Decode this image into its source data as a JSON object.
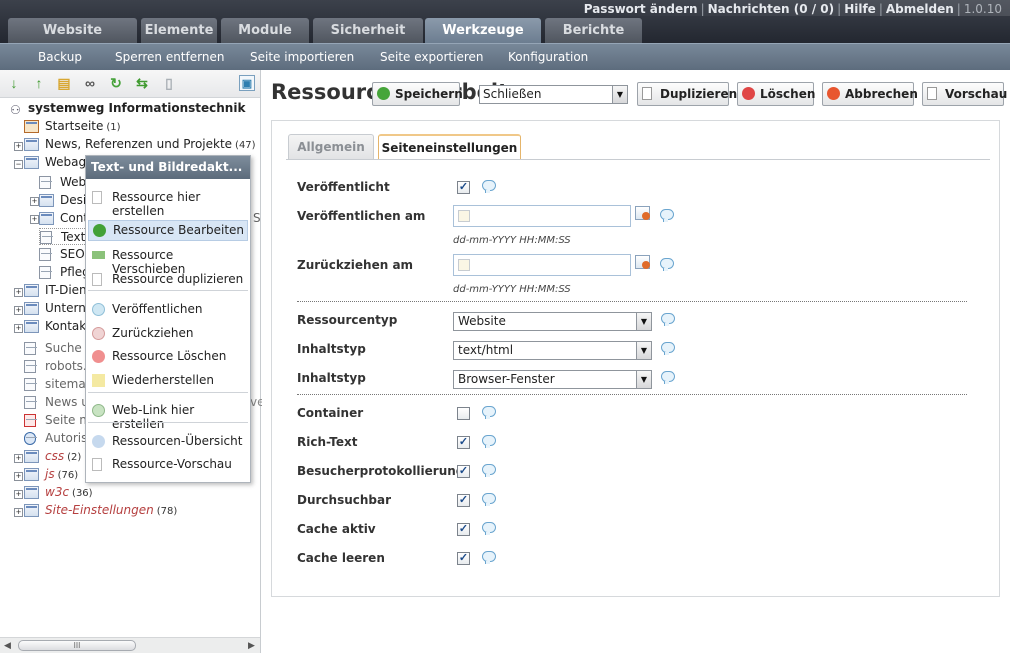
{
  "userbar": {
    "change_password": "Passwort ändern",
    "messages": "Nachrichten (0 / 0)",
    "help": "Hilfe",
    "logout": "Abmelden",
    "version": "1.0.10"
  },
  "tabs": [
    "Website",
    "Elemente",
    "Module",
    "Sicherheit",
    "Werkzeuge",
    "Berichte"
  ],
  "active_tab": "Werkzeuge",
  "submenu": [
    "Backup",
    "Sperren entfernen",
    "Seite importieren",
    "Seite exportieren",
    "Konfiguration"
  ],
  "tree": {
    "root": "systemweg Informationstechnik",
    "nodes": [
      {
        "label": "Startseite",
        "count": "(1)"
      },
      {
        "label": "News, Referenzen und Projekte",
        "count": "(47)"
      },
      {
        "label": "Webag",
        "count": ""
      },
      {
        "label": "Web",
        "count": ""
      },
      {
        "label": "Desi",
        "count": ""
      },
      {
        "label": "Cont",
        "count": ""
      },
      {
        "label": "Text-",
        "count": ""
      },
      {
        "label": "SEO",
        "count": ""
      },
      {
        "label": "Pfleg",
        "count": ""
      },
      {
        "label": "IT-Dien",
        "count": ""
      },
      {
        "label": "Untern",
        "count": ""
      },
      {
        "label": "Kontakt",
        "count": ""
      },
      {
        "label": "Suche",
        "count": ""
      },
      {
        "label": "robots.t",
        "count": ""
      },
      {
        "label": "sitemap",
        "count": ""
      },
      {
        "label": "News u",
        "count": ""
      },
      {
        "label": "Seite ni",
        "count": ""
      },
      {
        "label": "Autorisi",
        "count": ""
      },
      {
        "label": "css",
        "count": "(2)"
      },
      {
        "label": "js",
        "count": "(76)"
      },
      {
        "label": "w3c",
        "count": "(36)"
      },
      {
        "label": "Site-Einstellungen",
        "count": "(78)"
      }
    ],
    "overflow_s": "S",
    "overflow_ve": "ve",
    "scroll_grip": "III"
  },
  "context_menu": {
    "title": "Text- und Bildredakt...",
    "items": [
      "Ressource hier erstellen",
      "Ressource Bearbeiten",
      "Ressource Verschieben",
      "Ressource duplizieren",
      "Veröffentlichen",
      "Zurückziehen",
      "Ressource Löschen",
      "Wiederherstellen",
      "Web-Link hier erstellen",
      "Ressourcen-Übersicht",
      "Ressource-Vorschau"
    ]
  },
  "main": {
    "title": "Ressource /bearbeiten",
    "buttons": {
      "save": "Speichern",
      "duplicate": "Duplizieren",
      "delete": "Löschen",
      "cancel": "Abbrechen",
      "preview": "Vorschau"
    },
    "close_select": "Schließen",
    "form_tabs": [
      "Allgemein",
      "Seiteneinstellungen"
    ],
    "fields": {
      "published": "Veröffentlicht",
      "publish_on": "Veröffentlichen am",
      "unpublish_on": "Zurückziehen am",
      "date_hint": "dd-mm-YYYY HH:MM:SS",
      "resource_type": "Ressourcentyp",
      "resource_type_value": "Website",
      "content_type": "Inhaltstyp",
      "content_type_value": "text/html",
      "content_dispo": "Inhaltstyp",
      "content_dispo_value": "Browser-Fenster",
      "container": "Container",
      "richtext": "Rich-Text",
      "log": "Besucherprotokollierung",
      "searchable": "Durchsuchbar",
      "cacheable": "Cache aktiv",
      "clear_cache": "Cache leeren"
    }
  }
}
